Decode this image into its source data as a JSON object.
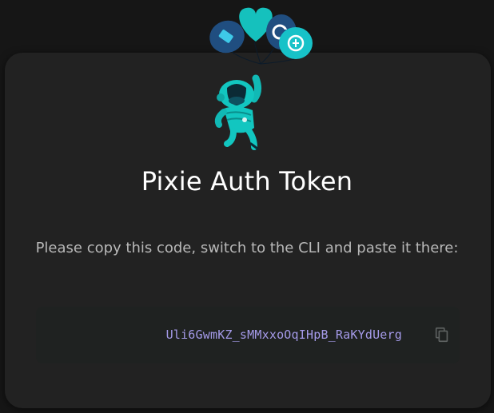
{
  "title": "Pixie Auth Token",
  "instruction": "Please copy this code, switch to the CLI and paste it there:",
  "token": "Uli6GwmKZ_sMMxxoOqIHpB_RaKYdUerg",
  "icons": {
    "balloons": "balloons-icon",
    "mascot": "pixie-mascot-icon",
    "copy": "copy-icon"
  },
  "colors": {
    "background": "#161616",
    "card": "#222222",
    "token_box": "#1f2221",
    "token_text": "#a49ae8",
    "accent_teal": "#12c6c0",
    "balloon_navy": "#1f4f82"
  }
}
